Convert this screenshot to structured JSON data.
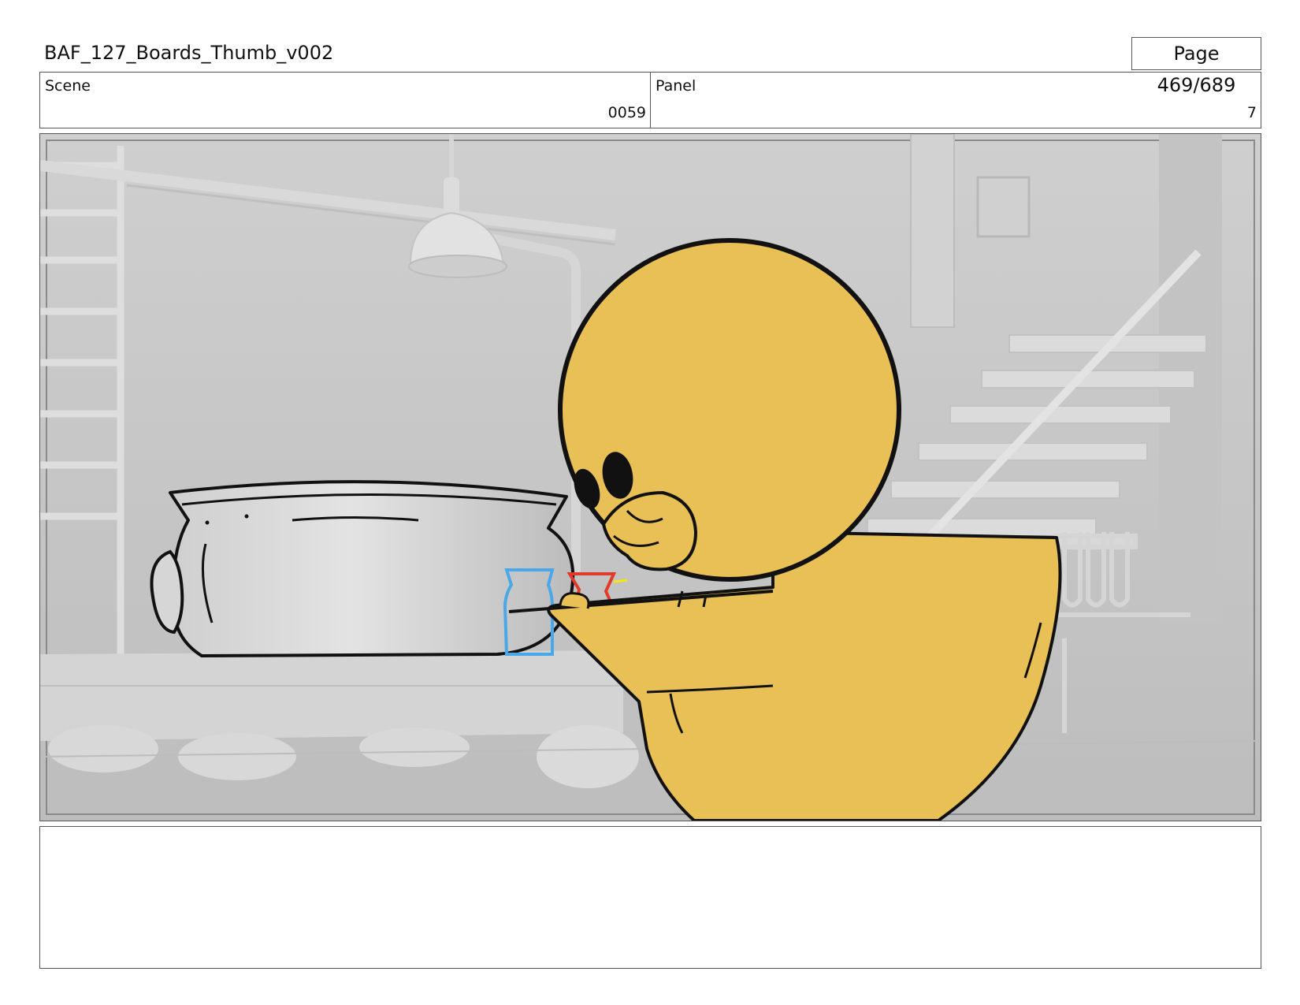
{
  "header": {
    "document_title": "BAF_127_Boards_Thumb_v002",
    "page_indicator": "Page 469/689"
  },
  "info": {
    "scene_label": "Scene",
    "scene_value": "0059",
    "panel_label": "Panel",
    "panel_value": "7"
  },
  "notes": {
    "text": ""
  },
  "colors": {
    "character_fill": "#e8c056",
    "background_gray": "#c9c9c9",
    "bottle_blue": "#4aa8e8",
    "bottle_red": "#e23a28"
  }
}
